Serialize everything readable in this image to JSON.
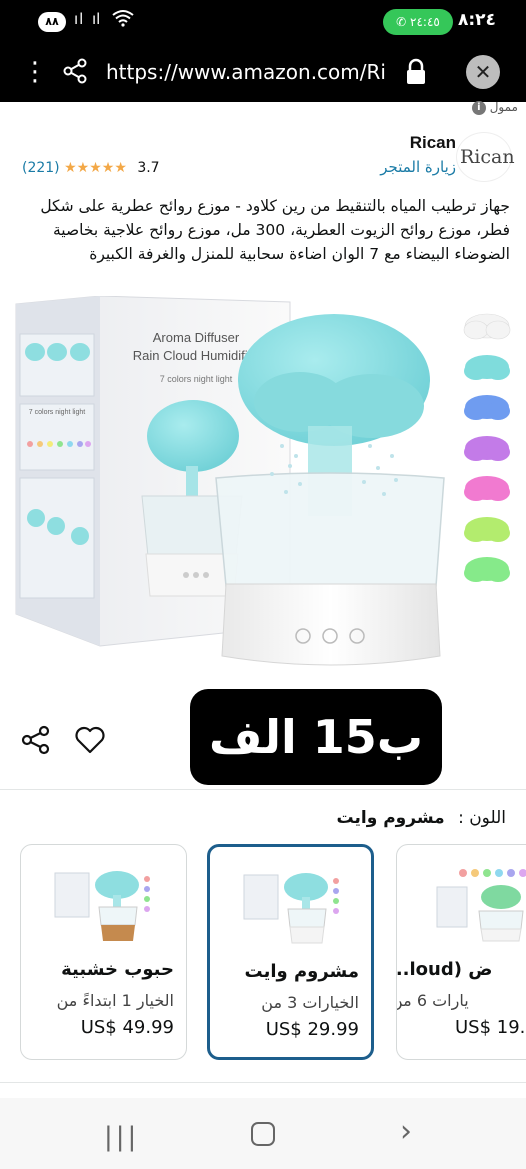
{
  "status_bar": {
    "badge": "٨٨",
    "call_time": "٢٤:٤٥",
    "time": "٨:٢٤"
  },
  "browser": {
    "url": "https://www.amazon.com/Ri",
    "icons": [
      "more-vert-icon",
      "share-icon",
      "lock-icon",
      "close-icon"
    ]
  },
  "sponsored": "ممول",
  "brand": {
    "logo_text": "Rican",
    "name": "Rican",
    "visit_store": "زيارة المتجر"
  },
  "rating": {
    "count": "(221)",
    "stars": "★★★★★",
    "score": "3.7",
    "value": 3.7
  },
  "title": "جهاز ترطيب المياه بالتنقيط من رين كلاود - موزع روائح عطرية على شكل فطر، موزع روائح الزيوت العطرية، 300 مل، موزع روائح علاجية بخاصية الضوضاء البيضاء مع 7 الوان اضاءة سحابية للمنزل والغرفة الكبيرة",
  "product_image": {
    "box_title_line1": "Aroma Diffuser",
    "box_title_line2": "Rain Cloud Humidifier",
    "box_subtitle": "7 colors night light",
    "box_inner_label": "7 colors night light"
  },
  "swatches": [
    "#f4f4f4",
    "#7fdcdc",
    "#6f9cf0",
    "#c37be8",
    "#f17ad0",
    "#b3ec6e",
    "#86ea8a"
  ],
  "price_banner": "ب15 الف",
  "color": {
    "label": "اللون :",
    "value": "مشروم وايت"
  },
  "variations": [
    {
      "name": "حبوب خشبية",
      "sub": "الخيار 1 ابتداءً من",
      "price": "US$ 49.99"
    },
    {
      "name": "مشروم وايت",
      "sub": "الخيارات 3 من",
      "price": "US$ 29.99"
    },
    {
      "name": "ض (loud...",
      "sub": "يارات 6 من",
      "price": "US$ 19."
    }
  ],
  "nav": {
    "recent": "|||",
    "back": "›"
  },
  "colors": {
    "accent": "#1a7ba6",
    "star": "#f3a847",
    "selected_border": "#1d5e8c",
    "call_green": "#35c759",
    "mist_blue": "#8edee0"
  }
}
